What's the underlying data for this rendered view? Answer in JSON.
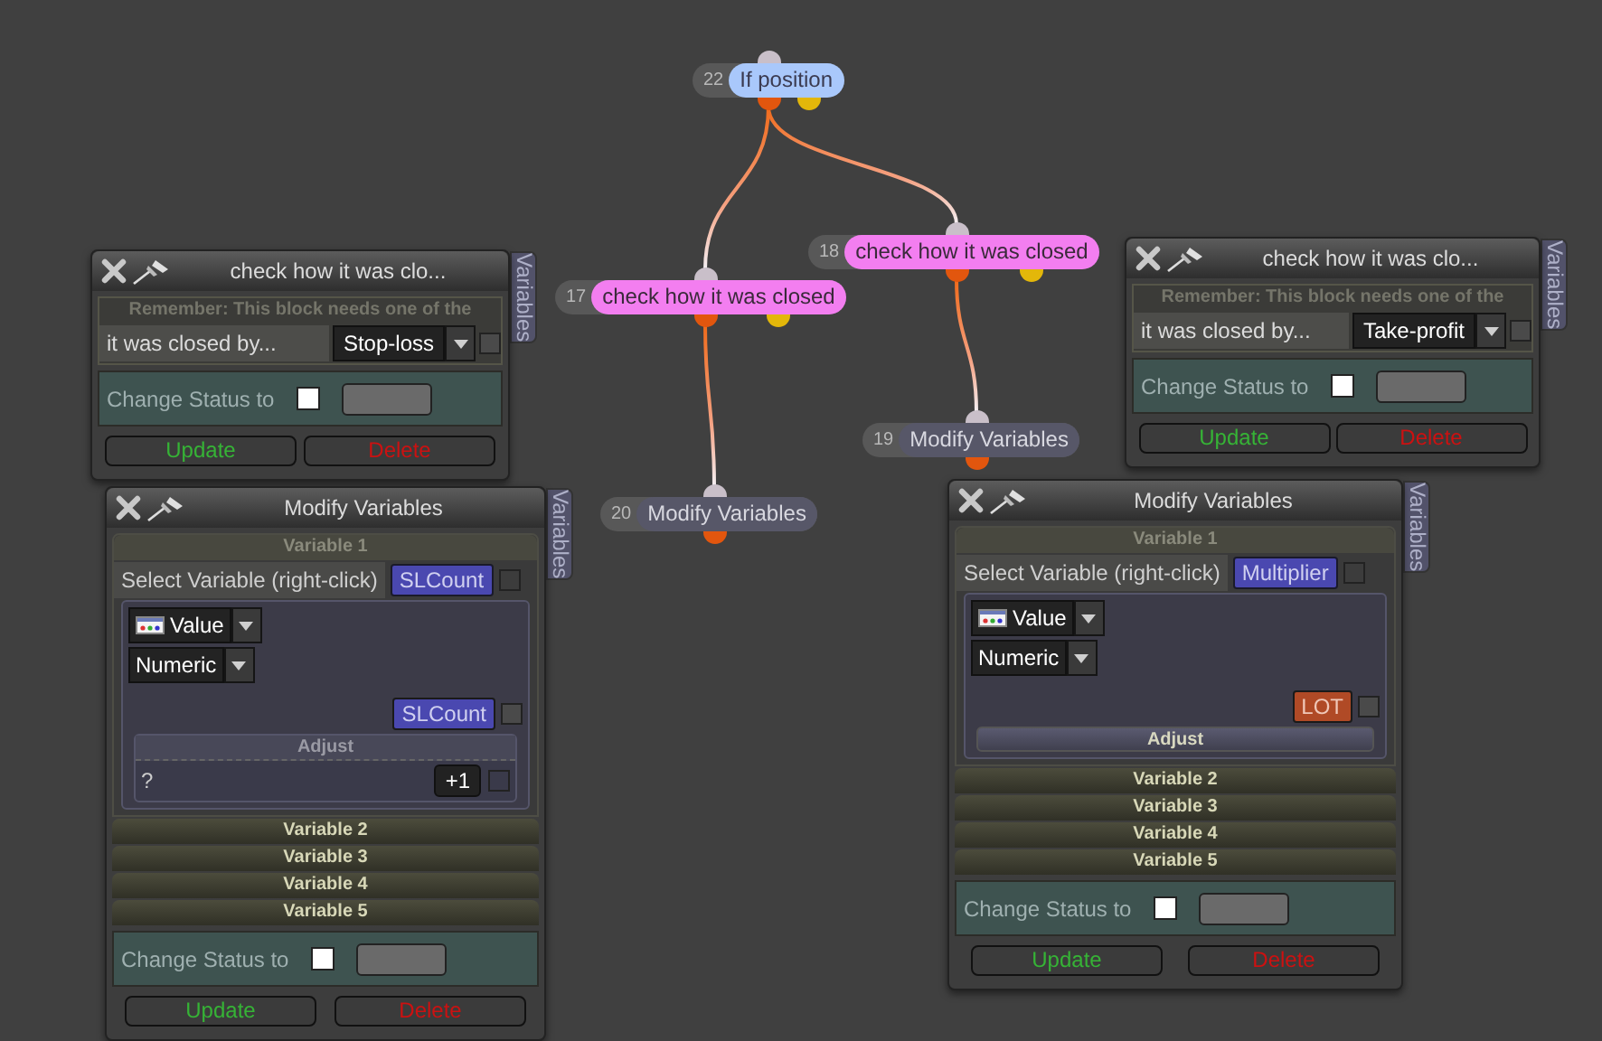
{
  "nodes": [
    {
      "number": "22",
      "label": "If position",
      "kind": "if",
      "children": [
        {
          "number": "17",
          "label": "check how it was closed",
          "kind": "check",
          "children": [
            {
              "number": "20",
              "label": "Modify Variables",
              "kind": "action"
            }
          ]
        },
        {
          "number": "18",
          "label": "check how it was closed",
          "kind": "check",
          "children": [
            {
              "number": "19",
              "label": "Modify Variables",
              "kind": "action"
            }
          ]
        }
      ]
    }
  ],
  "panels": [
    {
      "kind": "check",
      "title": "check how it was clo...",
      "tab": "Variables",
      "note": "Remember: This block needs one of the",
      "field_label": "it was closed by...",
      "dropdown": "Stop-loss",
      "option_checked": false,
      "status_label": "Change Status to",
      "status_checked": false,
      "buttons": [
        "Update",
        "Delete"
      ]
    },
    {
      "kind": "modify",
      "title": "Modify Variables",
      "tab": "Variables",
      "variables": [
        {
          "title": "Variable 1",
          "expanded": true,
          "select_label": "Select Variable (right-click)",
          "variable": "SLCount",
          "variable_checked": false,
          "value_type": "Value",
          "format": "Numeric",
          "operand": {
            "text": "SLCount",
            "kind": "variable",
            "checked": false
          },
          "adjust": {
            "title": "Adjust",
            "expanded": true,
            "text": "?",
            "button": "+1",
            "checked": false
          }
        },
        {
          "title": "Variable 2",
          "expanded": false
        },
        {
          "title": "Variable 3",
          "expanded": false
        },
        {
          "title": "Variable 4",
          "expanded": false
        },
        {
          "title": "Variable 5",
          "expanded": false
        }
      ],
      "status_label": "Change Status to",
      "status_checked": false,
      "buttons": [
        "Update",
        "Delete"
      ]
    },
    {
      "kind": "check",
      "title": "check how it was clo...",
      "tab": "Variables",
      "note": "Remember: This block needs one of the",
      "field_label": "it was closed by...",
      "dropdown": "Take-profit",
      "option_checked": false,
      "status_label": "Change Status to",
      "status_checked": false,
      "buttons": [
        "Update",
        "Delete"
      ]
    },
    {
      "kind": "modify",
      "title": "Modify Variables",
      "tab": "Variables",
      "variables": [
        {
          "title": "Variable 1",
          "expanded": true,
          "select_label": "Select Variable (right-click)",
          "variable": "Multiplier",
          "variable_checked": false,
          "value_type": "Value",
          "format": "Numeric",
          "operand": {
            "text": "LOT",
            "kind": "constant",
            "checked": false
          },
          "adjust": {
            "title": "Adjust",
            "expanded": false
          }
        },
        {
          "title": "Variable 2",
          "expanded": false
        },
        {
          "title": "Variable 3",
          "expanded": false
        },
        {
          "title": "Variable 4",
          "expanded": false
        },
        {
          "title": "Variable 5",
          "expanded": false
        }
      ],
      "status_label": "Change Status to",
      "status_checked": false,
      "buttons": [
        "Update",
        "Delete"
      ]
    }
  ]
}
